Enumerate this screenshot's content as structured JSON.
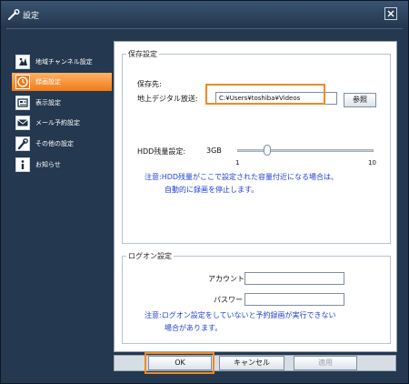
{
  "window": {
    "title": "設定",
    "accent_color": "#f08a24"
  },
  "sidebar": {
    "items": [
      {
        "label": "地域チャンネル設定",
        "icon": "region-channel-icon",
        "active": false
      },
      {
        "label": "録画設定",
        "icon": "record-clock-icon",
        "active": true
      },
      {
        "label": "表示設定",
        "icon": "display-icon",
        "active": false
      },
      {
        "label": "メール予約設定",
        "icon": "mail-icon",
        "active": false
      },
      {
        "label": "その他の設定",
        "icon": "wrench-icon",
        "active": false
      },
      {
        "label": "お知らせ",
        "icon": "info-icon",
        "active": false
      }
    ]
  },
  "save_settings": {
    "legend": "保存設定",
    "dest_label": "保存先:",
    "channel_label": "地上デジタル放送:",
    "path_value": "C:¥Users¥toshiba¥Videos",
    "browse_label": "参照",
    "hdd_label": "HDD残量設定:",
    "hdd_value": "3GB",
    "slider_min": "1",
    "slider_max": "10",
    "slider_level": 3,
    "note_line1": "注意:HDD残量がここで設定された容量付近になる場合は、",
    "note_line2": "自動的に録画を停止します。"
  },
  "logon_settings": {
    "legend": "ログオン設定",
    "account_label": "アカウント:",
    "account_value": "",
    "password_label": "パスワード:",
    "password_value": "",
    "note_line1": "注意:ログオン設定をしていないと予約録画が実行できない",
    "note_line2": "場合があります。"
  },
  "footer": {
    "ok_label": "OK",
    "cancel_label": "キャンセル",
    "apply_label": "適用"
  }
}
